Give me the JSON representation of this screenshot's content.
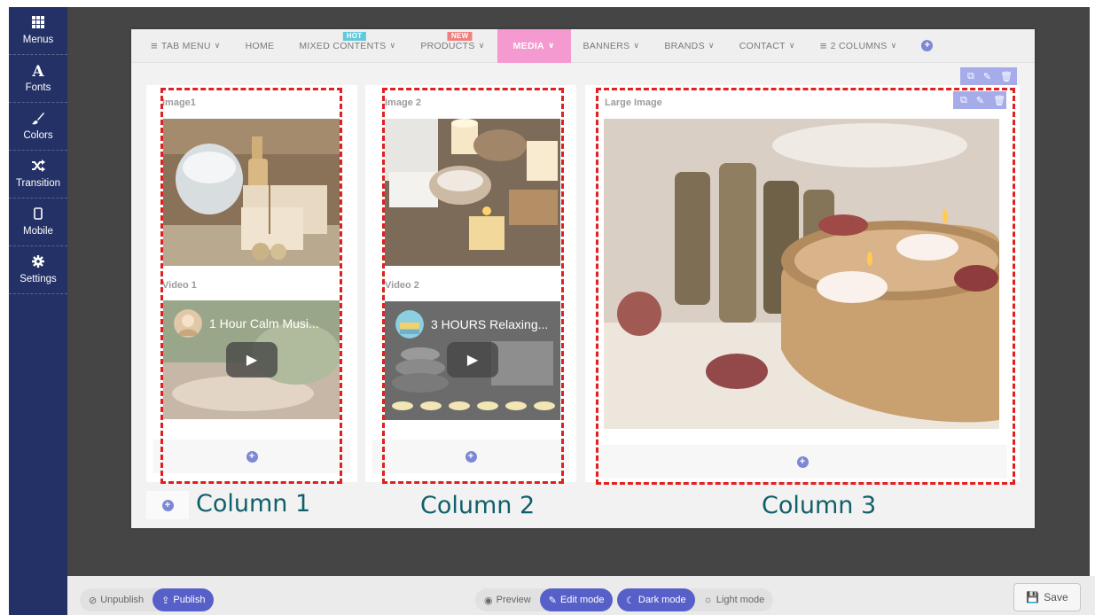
{
  "sidebar": {
    "items": [
      {
        "label": "Menus",
        "icon": "grid-icon"
      },
      {
        "label": "Fonts",
        "icon": "font-icon"
      },
      {
        "label": "Colors",
        "icon": "brush-icon"
      },
      {
        "label": "Transition",
        "icon": "shuffle-icon"
      },
      {
        "label": "Mobile",
        "icon": "mobile-icon"
      },
      {
        "label": "Settings",
        "icon": "gear-icon"
      }
    ]
  },
  "menubar": {
    "items": [
      {
        "label": "TAB MENU",
        "badge": ""
      },
      {
        "label": "HOME",
        "badge": ""
      },
      {
        "label": "MIXED CONTENTS",
        "badge": "HOT"
      },
      {
        "label": "PRODUCTS",
        "badge": "NEW"
      },
      {
        "label": "MEDIA",
        "badge": ""
      },
      {
        "label": "BANNERS",
        "badge": ""
      },
      {
        "label": "BRANDS",
        "badge": ""
      },
      {
        "label": "CONTACT",
        "badge": ""
      },
      {
        "label": "2 COLUMNS",
        "badge": ""
      }
    ],
    "active_color": "#f49ad0"
  },
  "columns": {
    "col1": {
      "image_label": "Image1",
      "video_label": "Video 1",
      "video_title": "1 Hour Calm Musi...",
      "caption": "Column 1"
    },
    "col2": {
      "image_label": "Image 2",
      "video_label": "Video 2",
      "video_title": "3 HOURS Relaxing...",
      "caption": "Column 2"
    },
    "col3": {
      "image_label": "Large Image",
      "caption": "Column 3"
    }
  },
  "bottombar": {
    "unpublish": "Unpublish",
    "publish": "Publish",
    "preview": "Preview",
    "edit_mode": "Edit mode",
    "dark_mode": "Dark mode",
    "light_mode": "Light mode",
    "save": "Save"
  },
  "colors": {
    "sidebar": "#243166",
    "accent": "#5660c8",
    "highlight_dash": "#e02020",
    "caption": "#10606a"
  }
}
